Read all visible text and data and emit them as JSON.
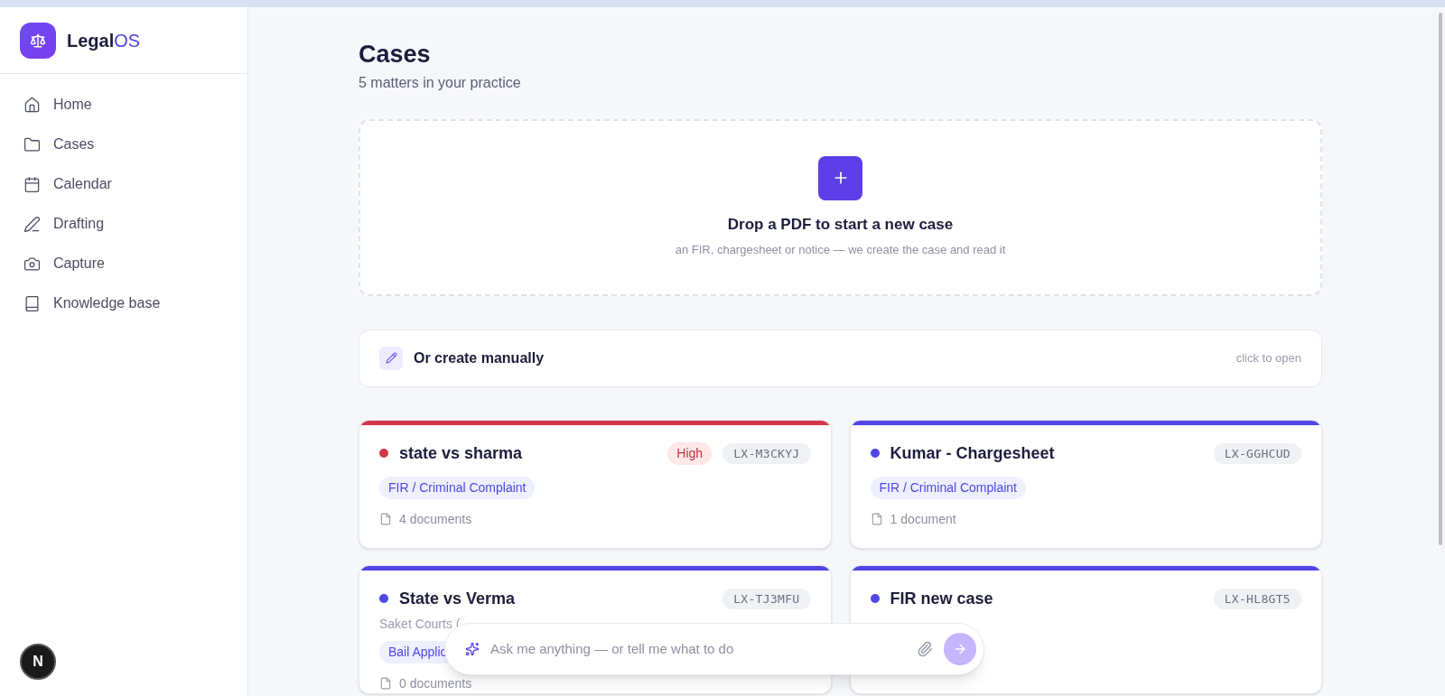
{
  "brand": {
    "name_start": "Legal",
    "name_end": "OS"
  },
  "sidebar": {
    "items": [
      {
        "label": "Home",
        "selected": false
      },
      {
        "label": "Cases",
        "selected": false
      },
      {
        "label": "Calendar",
        "selected": false
      },
      {
        "label": "Drafting",
        "selected": false
      },
      {
        "label": "Capture",
        "selected": false
      },
      {
        "label": "Knowledge base",
        "selected": false
      }
    ]
  },
  "page": {
    "title": "Cases",
    "subtitle": "5 matters in your practice"
  },
  "dropzone": {
    "title": "Drop a PDF to start a new case",
    "hint": "an FIR, chargesheet or notice — we create the case and read it"
  },
  "manual": {
    "label": "Or create manually",
    "hint": "click to open"
  },
  "cases": [
    {
      "title": "state vs sharma",
      "color": "#d13745",
      "priority": "High",
      "code": "LX-M3CKYJ",
      "tag": "FIR / Criminal Complaint",
      "documents": "4 documents"
    },
    {
      "title": "Kumar - Chargesheet",
      "color": "#4f46e5",
      "code": "LX-GGHCUD",
      "tag": "FIR / Criminal Complaint",
      "documents": "1 document"
    },
    {
      "title": "State vs Verma",
      "color": "#4f46e5",
      "code": "LX-TJ3MFU",
      "court": "Saket Courts (",
      "tag": "Bail Applic",
      "documents": "0 documents"
    },
    {
      "title": "FIR new case",
      "color": "#4f46e5",
      "code": "LX-HL8GT5"
    }
  ],
  "assistant": {
    "placeholder": "Ask me anything — or tell me what to do"
  },
  "badge": {
    "letter": "N"
  }
}
